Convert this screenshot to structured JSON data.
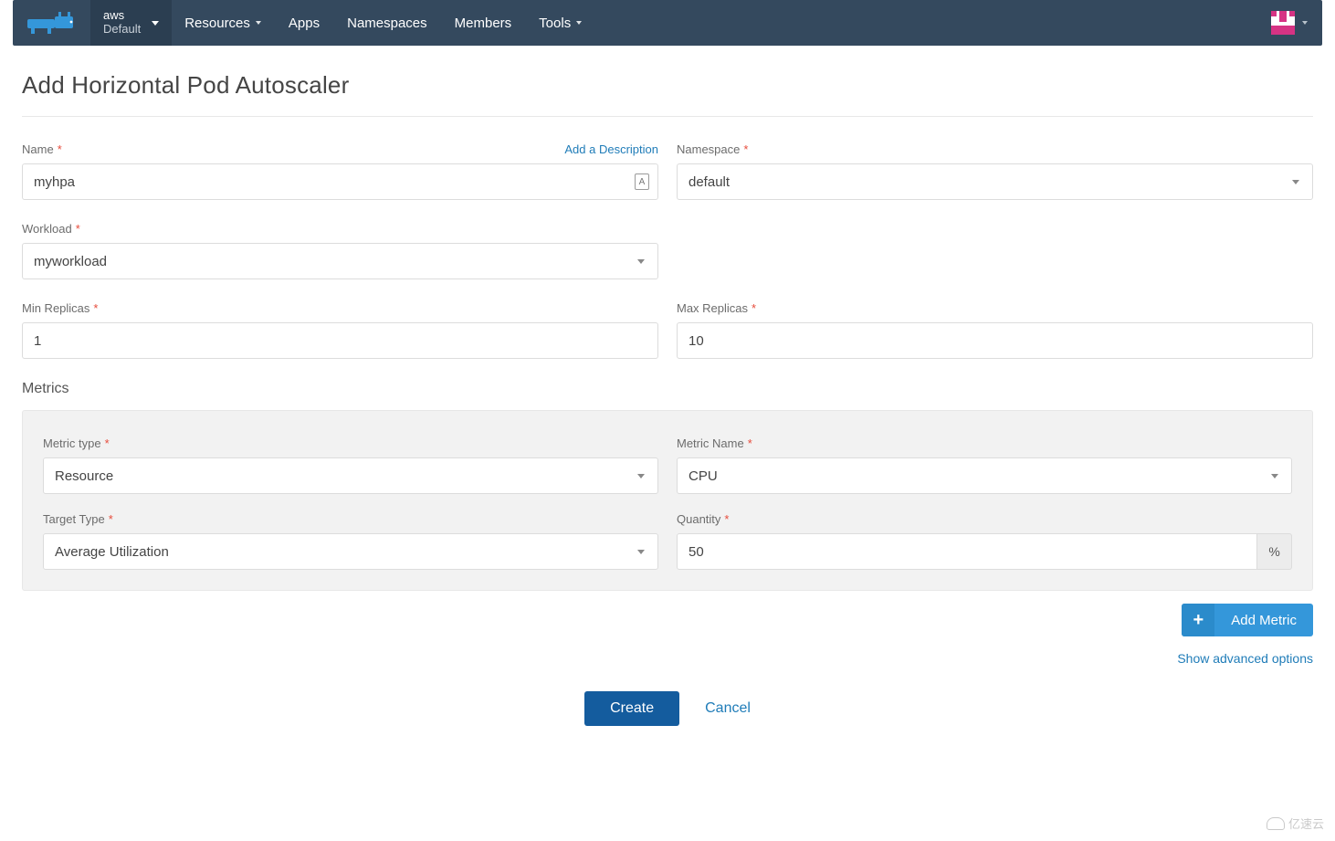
{
  "nav": {
    "cluster_top": "aws",
    "cluster_bottom": "Default",
    "items": [
      "Resources",
      "Apps",
      "Namespaces",
      "Members",
      "Tools"
    ],
    "items_has_chev": [
      true,
      false,
      false,
      false,
      true
    ]
  },
  "page": {
    "title": "Add Horizontal Pod Autoscaler"
  },
  "form": {
    "name_label": "Name",
    "name_value": "myhpa",
    "add_description": "Add a Description",
    "namespace_label": "Namespace",
    "namespace_value": "default",
    "workload_label": "Workload",
    "workload_value": "myworkload",
    "min_label": "Min Replicas",
    "min_value": "1",
    "max_label": "Max Replicas",
    "max_value": "10"
  },
  "metrics": {
    "section_title": "Metrics",
    "type_label": "Metric type",
    "type_value": "Resource",
    "name_label": "Metric Name",
    "name_value": "CPU",
    "target_label": "Target Type",
    "target_value": "Average Utilization",
    "quantity_label": "Quantity",
    "quantity_value": "50",
    "quantity_unit": "%",
    "add_metric": "Add Metric",
    "advanced": "Show advanced options"
  },
  "actions": {
    "create": "Create",
    "cancel": "Cancel"
  },
  "watermark": "亿速云"
}
